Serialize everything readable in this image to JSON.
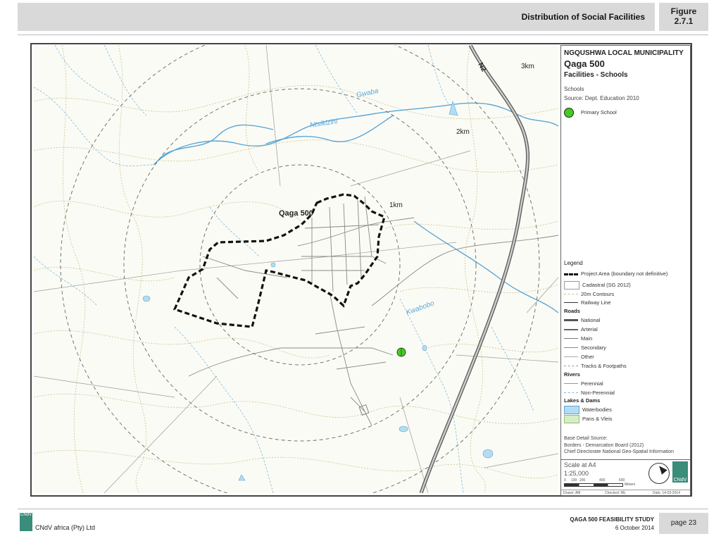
{
  "header": {
    "title": "Distribution of Social Facilities",
    "figure_label": "Figure",
    "figure_number": "2.7.1"
  },
  "map": {
    "labels": {
      "road_n2": "N2",
      "ring_3km": "3km",
      "ring_2km": "2km",
      "ring_1km": "1km",
      "project_name": "Qaga 500",
      "river_gwaba": "Gwaba",
      "river_ntsikizini": "Ntsikizini",
      "river_kwabobo": "Kwabobo"
    }
  },
  "panel": {
    "municipality": "NGQUSHWA LOCAL MUNICIPALITY",
    "project": "Qaga 500",
    "subtitle": "Facilities - Schools",
    "schools_heading": "Schools",
    "schools_source": "Source: Dept. Education 2010",
    "primary_school": "Primary School",
    "legend_title": "Legend",
    "legend": {
      "project_area": "Project Area (boundary not definitive)",
      "cadastral": "Cadastral (SG 2012)",
      "contours": "20m Contours",
      "railway": "Railway Line",
      "roads_head": "Roads",
      "national": "National",
      "arterial": "Arterial",
      "main": "Main",
      "secondary": "Secondary",
      "other": "Other",
      "tracks": "Tracks & Footpaths",
      "rivers_head": "Rivers",
      "perennial": "Perennial",
      "non_perennial": "Non-Perennial",
      "lakes_head": "Lakes & Dams",
      "waterbodies": "Waterbodies",
      "pans": "Pans & Vleis"
    },
    "base_source_title": "Base Detail Source:",
    "base_source_1": "Borders - Demarcation Board (2012)",
    "base_source_2": "Chief Directorate National Geo-Spatial Information"
  },
  "scale": {
    "label": "Scale at A4",
    "ratio": "1:25,000",
    "ticks": [
      "0",
      "100",
      "200",
      "400",
      "600"
    ],
    "unit": "Meters",
    "drawn": "Drawn: AM",
    "checked": "Checked: RE",
    "date": "Date: 14-03-2014",
    "logo": "CNdV"
  },
  "footer": {
    "logo": "CNdV",
    "company": "CNdV africa (Pty) Ltd",
    "study": "QAGA 500 FEASIBILITY STUDY",
    "date": "6 October 2014",
    "page": "page 23"
  },
  "colors": {
    "river": "#5ba7d8",
    "contour": "#c8c28a",
    "road": "#888888",
    "school": "#44cc22",
    "project_boundary": "#111111"
  }
}
